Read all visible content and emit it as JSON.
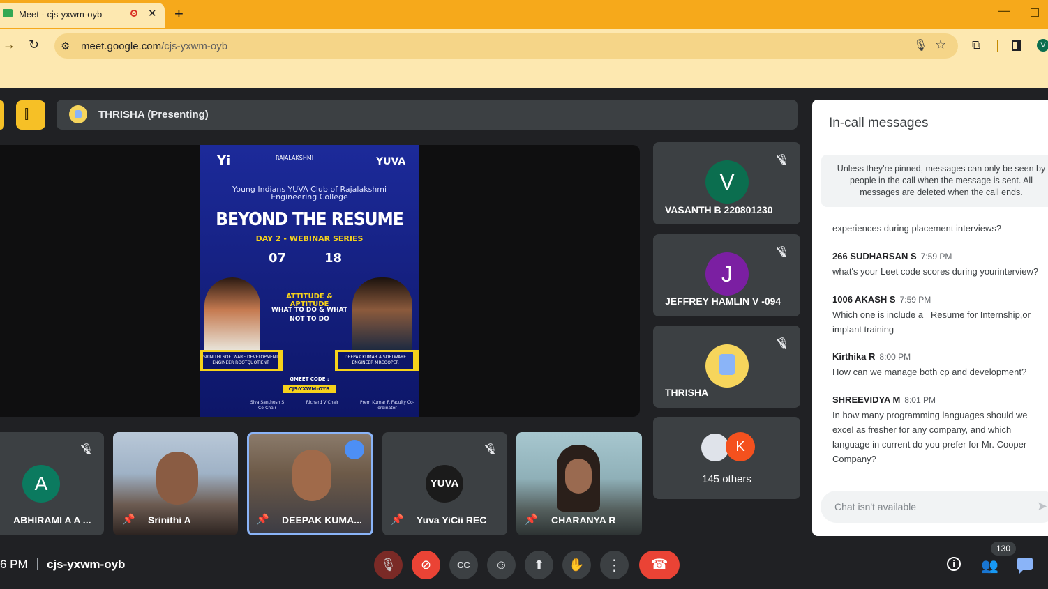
{
  "browser": {
    "tab_title": "Meet - cjs-yxwm-oyb",
    "tab_close": "✕",
    "new_tab": "+",
    "url_host": "meet.google.com",
    "url_path": "/cjs-yxwm-oyb",
    "profile_initial": "V"
  },
  "presenting": {
    "label": "THRISHA (Presenting)"
  },
  "poster": {
    "logo_left": "Yi",
    "logo_center": "RAJALAKSHMI",
    "logo_right": "YUVA",
    "org": "Young Indians YUVA Club of Rajalakshmi Engineering College",
    "headline": "BEYOND THE RESUME",
    "day": "DAY 2 - WEBINAR SERIES",
    "date_left": "07",
    "date_right": "18",
    "topic": "ATTITUDE & APTITUDE",
    "what": "WHAT TO DO & WHAT NOT TO DO",
    "speaker1": "SRINITHI SOFTWARE DEVELOPMENT ENGINEER ROOTQUOTIENT",
    "speaker2": "DEEPAK KUMAR A SOFTWARE ENGINEER MRCOOPER",
    "gmeet_label": "GMEET CODE :",
    "gmeet_code": "CJS-YXWM-OYB",
    "foot1": "Siva Santhosh S Co-Chair",
    "foot2": "Richard V Chair",
    "foot3": "Prem Kumar R Faculty Co-ordinator"
  },
  "side_tiles": [
    {
      "initial": "V",
      "name": "VASANTH B 220801230",
      "color": "#0b6e4f"
    },
    {
      "initial": "J",
      "name": "JEFFREY HAMLIN V -094",
      "color": "#7b1fa2"
    },
    {
      "name": "THRISHA"
    },
    {
      "initial": "K",
      "name": "145 others",
      "color": "#f4511e"
    }
  ],
  "bottom_tiles": [
    {
      "initial": "A",
      "name": "ABHIRAMI A A ...",
      "color": "#0b7a5f"
    },
    {
      "name": "Srinithi A"
    },
    {
      "name": "DEEPAK KUMA..."
    },
    {
      "logo": "YUVA",
      "name": "Yuva YiCii REC"
    },
    {
      "name": "CHARANYA R"
    }
  ],
  "chat": {
    "title": "In-call messages",
    "notice": "Unless they're pinned, messages can only be seen by people in the call when the message is sent. All messages are deleted when the call ends.",
    "partial_message": "experiences during placement interviews?",
    "messages": [
      {
        "sender": "266 SUDHARSAN S",
        "time": "7:59 PM",
        "text": "what's your Leet code scores during yourinterview?"
      },
      {
        "sender": "1006 AKASH S",
        "time": "7:59 PM",
        "text": "Which one is include a   Resume for Internship,or implant training"
      },
      {
        "sender": "Kirthika R",
        "time": "8:00 PM",
        "text": "How can we manage both cp and development?"
      },
      {
        "sender": "SHREEVIDYA M",
        "time": "8:01 PM",
        "text": "In how many programming languages should we excel as fresher for any company, and which language in current do you prefer for Mr. Cooper Company?"
      }
    ],
    "input_placeholder": "Chat isn't available"
  },
  "bottom_bar": {
    "time": "6 PM",
    "meeting_code": "cjs-yxwm-oyb",
    "participant_count": "130"
  },
  "icons": {
    "mic_off": "mic-off-icon",
    "camera_off": "camera-off-icon",
    "captions": "captions-icon",
    "emoji": "emoji-icon",
    "present": "present-icon",
    "hand": "raise-hand-icon",
    "more": "more-vert-icon",
    "leave": "call-end-icon"
  },
  "colors": {
    "browser_accent": "#f6a91b",
    "meet_bg": "#202124",
    "tile_bg": "#3c4043",
    "danger": "#ea4335",
    "active_speaker": "#8ab4f8"
  }
}
